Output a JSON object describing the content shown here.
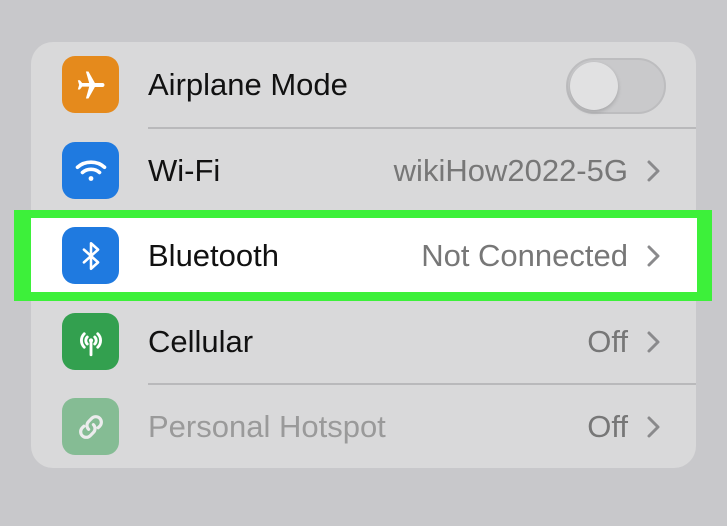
{
  "settings": {
    "rows": [
      {
        "label": "Airplane Mode",
        "icon": "airplane-icon",
        "color": "#e58a1c",
        "type": "toggle",
        "toggle_on": false
      },
      {
        "label": "Wi-Fi",
        "value": "wikiHow2022-5G",
        "icon": "wifi-icon",
        "color": "#1f7ae0",
        "type": "link"
      },
      {
        "label": "Bluetooth",
        "value": "Not Connected",
        "icon": "bluetooth-icon",
        "color": "#1f7ae0",
        "type": "link",
        "highlighted": true
      },
      {
        "label": "Cellular",
        "value": "Off",
        "icon": "cellular-antenna-icon",
        "color": "#33a04f",
        "type": "link"
      },
      {
        "label": "Personal Hotspot",
        "value": "Off",
        "icon": "hotspot-link-icon",
        "color": "#33a04f",
        "type": "link",
        "dimmed": true
      }
    ]
  },
  "colors": {
    "highlight": "#3df03a",
    "background": "#c8c8cb",
    "card": "#d9d9da"
  }
}
